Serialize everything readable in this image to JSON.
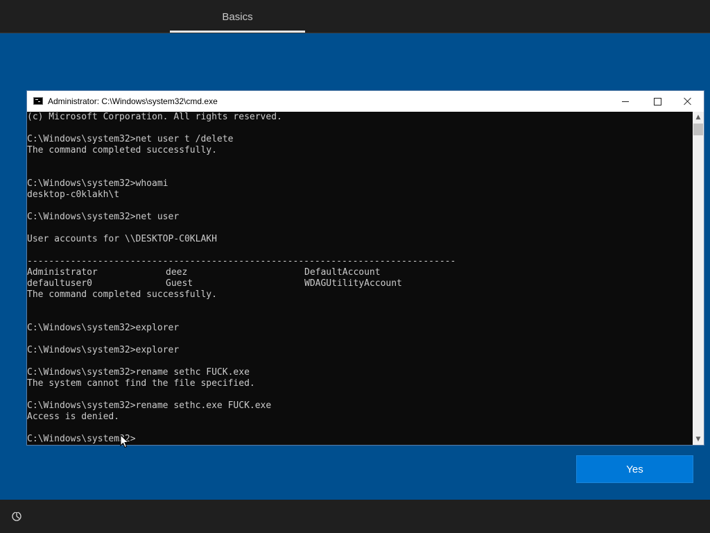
{
  "header": {
    "tab_label": "Basics"
  },
  "cmd": {
    "title": "Administrator: C:\\Windows\\system32\\cmd.exe",
    "lines": [
      "(c) Microsoft Corporation. All rights reserved.",
      "",
      "C:\\Windows\\system32>net user t /delete",
      "The command completed successfully.",
      "",
      "",
      "C:\\Windows\\system32>whoami",
      "desktop-c0klakh\\t",
      "",
      "C:\\Windows\\system32>net user",
      "",
      "User accounts for \\\\DESKTOP-C0KLAKH",
      "",
      "-------------------------------------------------------------------------------",
      "",
      "",
      "The command completed successfully.",
      "",
      "",
      "C:\\Windows\\system32>explorer",
      "",
      "C:\\Windows\\system32>explorer",
      "",
      "C:\\Windows\\system32>rename sethc FUCK.exe",
      "The system cannot find the file specified.",
      "",
      "C:\\Windows\\system32>rename sethc.exe FUCK.exe",
      "Access is denied.",
      "",
      "C:\\Windows\\system32>"
    ],
    "accounts": [
      [
        "Administrator",
        "deez",
        "DefaultAccount"
      ],
      [
        "defaultuser0",
        "Guest",
        "WDAGUtilityAccount"
      ]
    ]
  },
  "buttons": {
    "yes_label": "Yes"
  },
  "icons": {
    "accessibility": "accessibility-icon",
    "cmd": "cmd-app-icon"
  },
  "colors": {
    "background": "#004f8f",
    "bar": "#1f1f1f",
    "accent": "#0078d7",
    "console_bg": "#0c0c0c",
    "console_text": "#cccccc"
  }
}
